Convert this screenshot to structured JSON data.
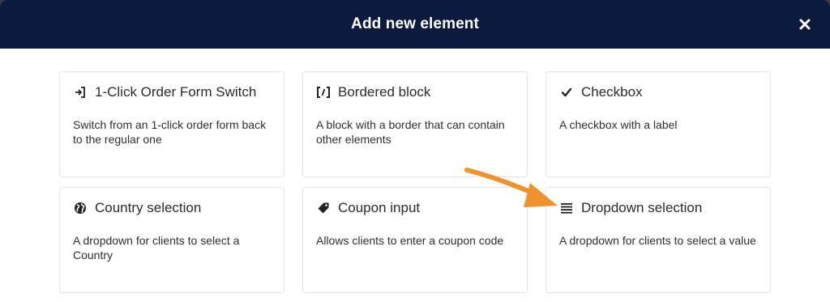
{
  "modal": {
    "title": "Add new element",
    "close_icon": "close-icon",
    "header_color": "#0b1a3d",
    "arrow_color": "#f0922e"
  },
  "elements": [
    {
      "icon": "sign-in-icon",
      "title": "1-Click Order Form Switch",
      "description": "Switch from an 1-click order form back to the regular one"
    },
    {
      "icon": "brackets-icon",
      "title": "Bordered block",
      "description": "A block with a border that can contain other elements"
    },
    {
      "icon": "check-icon",
      "title": "Checkbox",
      "description": "A checkbox with a label"
    },
    {
      "icon": "globe-icon",
      "title": "Country selection",
      "description": "A dropdown for clients to select a Country"
    },
    {
      "icon": "tag-icon",
      "title": "Coupon input",
      "description": "Allows clients to enter a coupon code"
    },
    {
      "icon": "list-icon",
      "title": "Dropdown selection",
      "description": "A dropdown for clients to select a value"
    }
  ]
}
